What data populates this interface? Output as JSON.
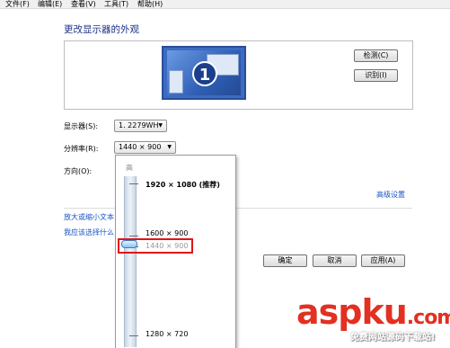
{
  "menubar": {
    "items": [
      "文件(F)",
      "编辑(E)",
      "查看(V)",
      "工具(T)",
      "帮助(H)"
    ]
  },
  "title": "更改显示器的外观",
  "preview": {
    "monitor_number": "1",
    "detect_label": "检测(C)",
    "identify_label": "识别(I)"
  },
  "settings": {
    "display_label": "显示器(S):",
    "display_value": "1. 2279WH",
    "resolution_label": "分辨率(R):",
    "resolution_value": "1440 × 900",
    "orientation_label": "方向(O):"
  },
  "resolution_dropdown": {
    "high_label": "高",
    "options": [
      "1920 × 1080 (推荐)",
      "1600 × 900",
      "1440 × 900",
      "1280 × 720"
    ],
    "selected": "1440 × 900"
  },
  "links": {
    "advanced": "高级设置",
    "enlarge": "放大或缩小文本",
    "which": "我应该选择什么"
  },
  "buttons": {
    "ok": "确定",
    "cancel": "取消",
    "apply": "应用(A)"
  },
  "watermark": {
    "brand": "aspku",
    "domain_suffix": ".com",
    "tagline": "免费网站源码下载站!"
  },
  "colors": {
    "title": "#1e3287",
    "link": "#1a56c4",
    "highlight": "#e0141a",
    "watermark": "#e23022",
    "monitor": "#3d6bc1"
  }
}
